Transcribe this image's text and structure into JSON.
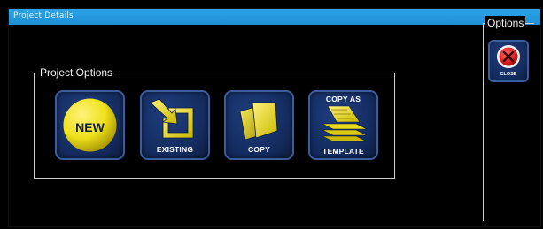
{
  "window": {
    "title": "Project Details"
  },
  "project_options": {
    "legend": "Project Options",
    "tiles": [
      {
        "label": "NEW",
        "icon": "new-circle-icon"
      },
      {
        "label": "EXISTING",
        "icon": "existing-arrow-icon"
      },
      {
        "label": "COPY",
        "icon": "copy-pages-icon"
      },
      {
        "label_top": "COPY AS",
        "label_bottom": "TEMPLATE",
        "icon": "template-stack-icon"
      }
    ]
  },
  "options": {
    "legend": "Options",
    "close_label": "CLOSE",
    "close_icon": "close-icon"
  },
  "colors": {
    "titlebar": "#2ea3e6",
    "tile_background": "#132a5c",
    "tile_border": "#3c5d9c",
    "icon_yellow": "#f2e01a",
    "close_red": "#e02020"
  }
}
